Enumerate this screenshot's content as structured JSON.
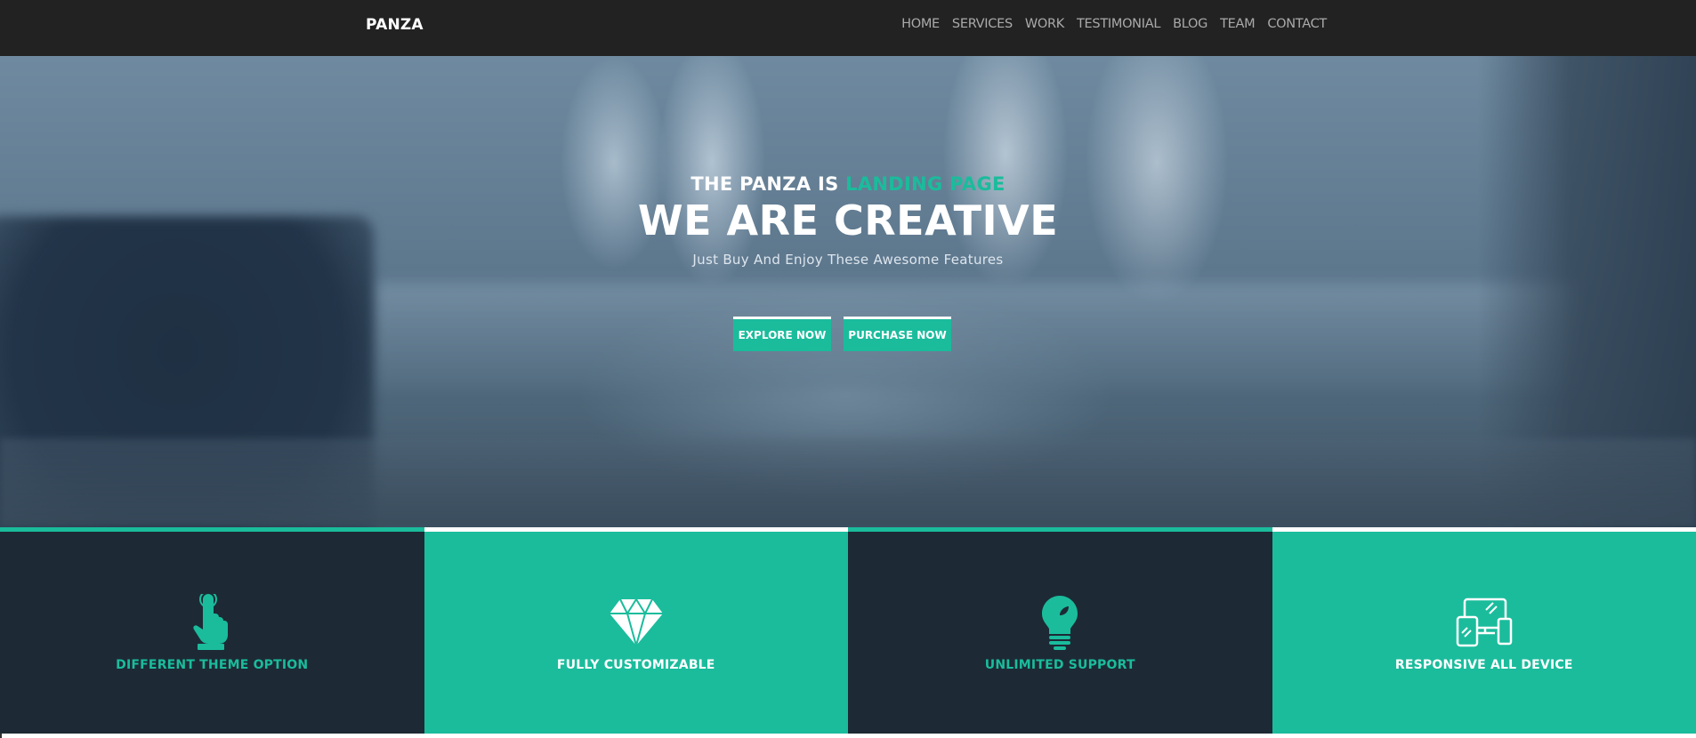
{
  "brand": "PANZA",
  "nav": {
    "items": [
      "HOME",
      "SERVICES",
      "WORK",
      "TESTIMONIAL",
      "BLOG",
      "TEAM",
      "CONTACT"
    ]
  },
  "hero": {
    "tagline_prefix": "THE PANZA IS ",
    "tagline_accent": "LANDING PAGE",
    "headline": "WE ARE CREATIVE",
    "subline": "Just Buy And Enjoy These Awesome Features",
    "buttons": {
      "explore": "EXPLORE NOW",
      "purchase": "PURCHASE NOW"
    }
  },
  "features": [
    {
      "label": "DIFFERENT THEME OPTION",
      "icon": "pointer-hand-icon"
    },
    {
      "label": "FULLY CUSTOMIZABLE",
      "icon": "diamond-icon"
    },
    {
      "label": "UNLIMITED SUPPORT",
      "icon": "lightbulb-icon"
    },
    {
      "label": "RESPONSIVE ALL DEVICE",
      "icon": "devices-icon"
    }
  ],
  "colors": {
    "accent": "#1abc9c",
    "navbar": "#222222",
    "dark_panel": "#1d2a35"
  }
}
